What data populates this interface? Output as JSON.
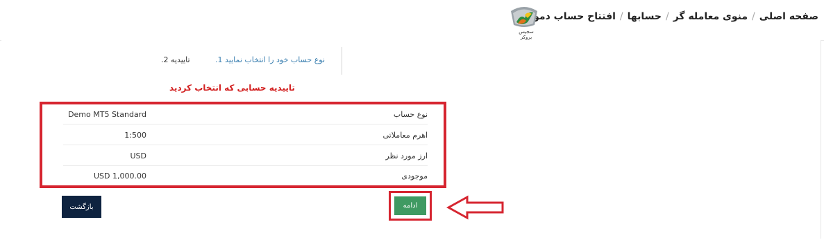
{
  "breadcrumb": {
    "home": "صفحه اصلی",
    "trader_menu": "منوی معامله گر",
    "accounts": "حسابها",
    "current": "افتتاح حساب دمو",
    "separator": "/"
  },
  "logo": {
    "text": "سجیس بروکر"
  },
  "steps": {
    "step1": "نوع حساب خود را انتخاب نمایید 1.",
    "step2": "تاییدیه 2."
  },
  "confirmation_message": "تاییدیه حسابی که انتخاب کردید",
  "account_info": [
    {
      "label": "نوع حساب",
      "value": "Demo MT5 Standard"
    },
    {
      "label": "اهرم معاملاتی",
      "value": "1:500"
    },
    {
      "label": "ارز مورد نظر",
      "value": "USD"
    },
    {
      "label": "موجودی",
      "value": "USD 1,000.00"
    }
  ],
  "buttons": {
    "continue": "ادامه",
    "back": "بازگشت"
  },
  "colors": {
    "highlight_red": "#d62530",
    "continue_green": "#3f9a62",
    "back_navy": "#0e2340",
    "confirm_text": "#d32222",
    "step_link": "#3a7fb0"
  }
}
